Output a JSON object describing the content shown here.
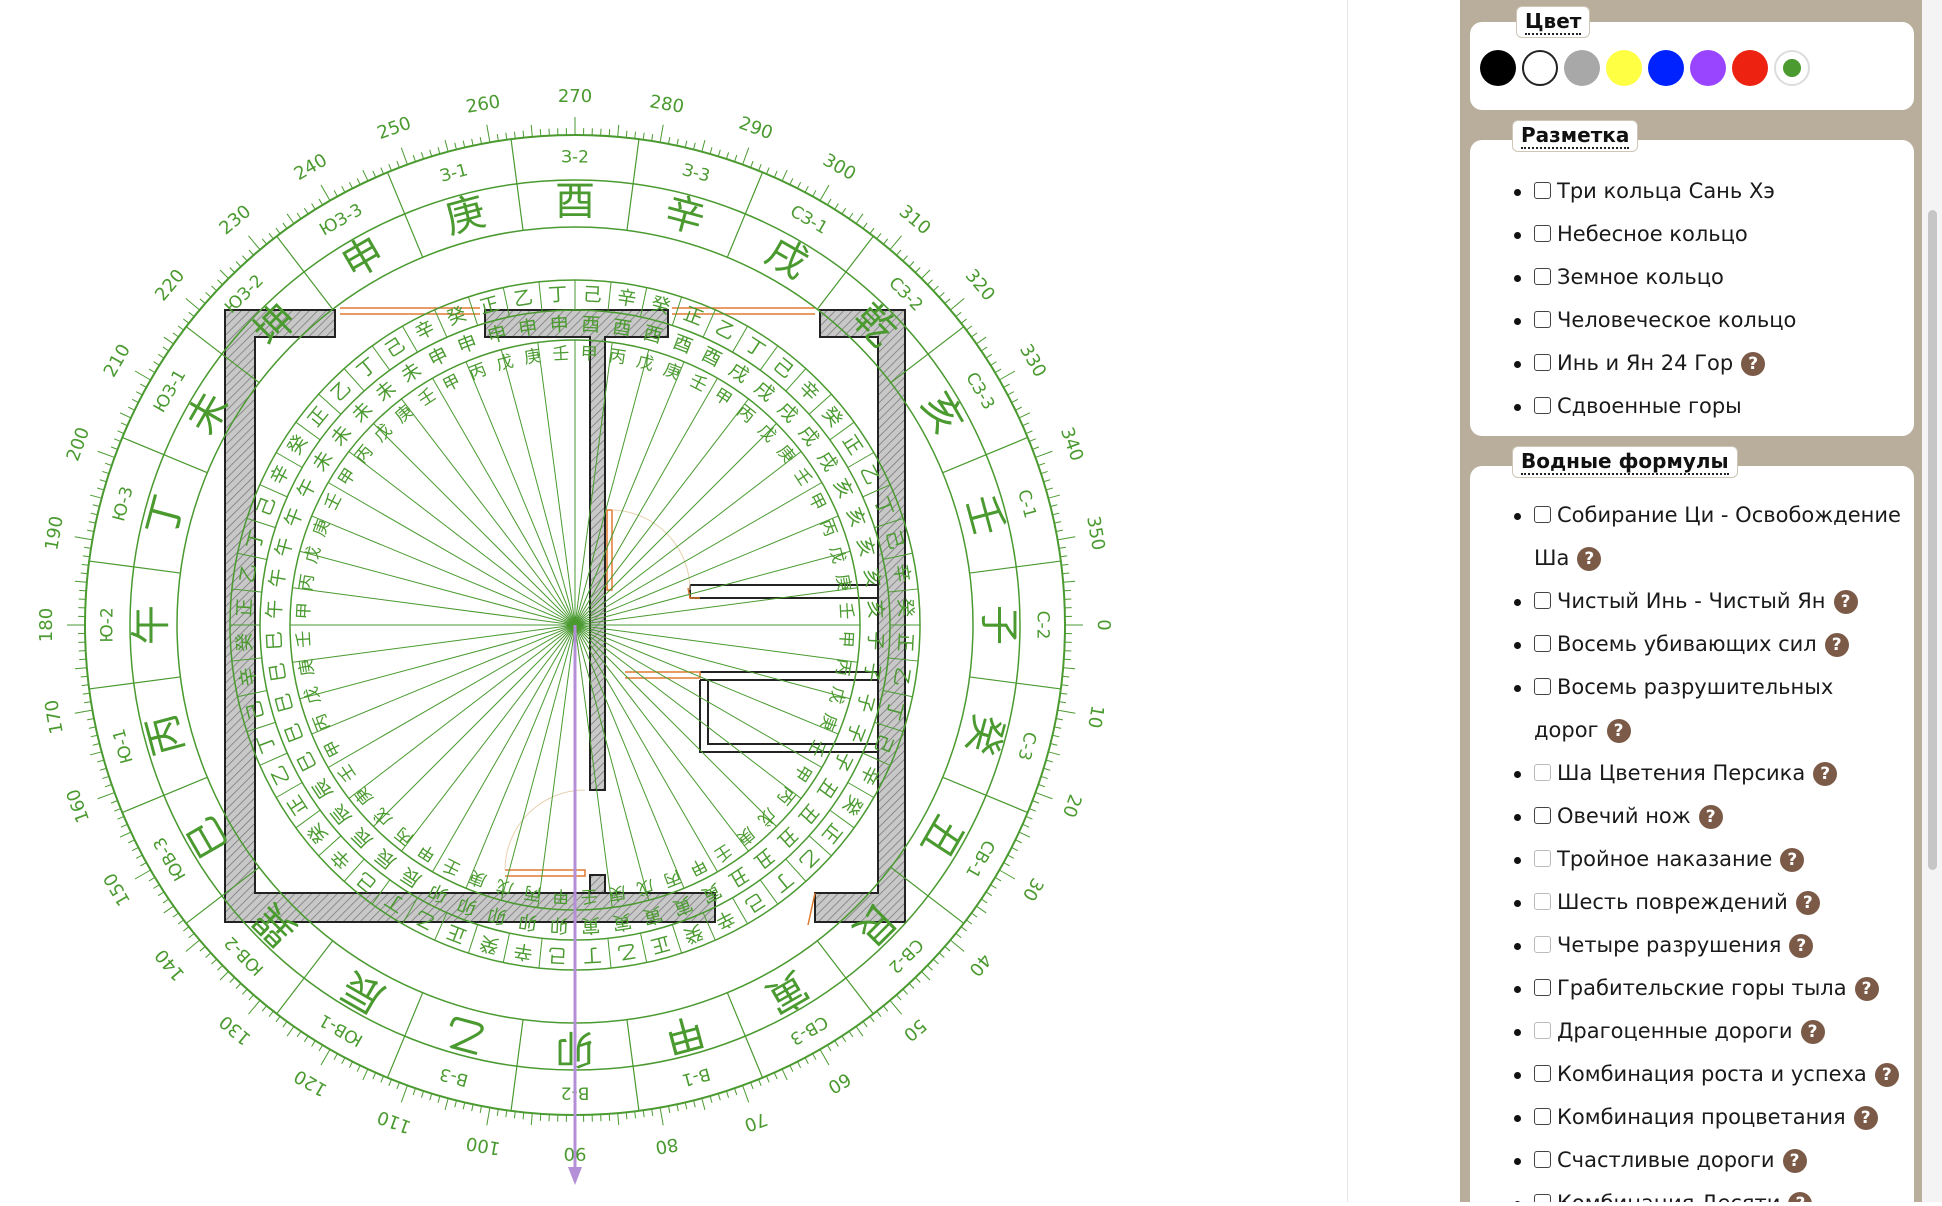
{
  "panel": {
    "color_group": {
      "title": "Цвет",
      "swatches": [
        "#000000",
        "#ffffff",
        "#a8a8a8",
        "#ffff44",
        "#0022ff",
        "#9944ff",
        "#ee2211",
        "#4a9a30"
      ],
      "selected": "#4a9a30"
    },
    "markup_group": {
      "title": "Разметка",
      "items": [
        {
          "label": "Три кольца Сань Хэ",
          "help": false
        },
        {
          "label": "Небесное кольцо",
          "help": false
        },
        {
          "label": "Земное кольцо",
          "help": false
        },
        {
          "label": "Человеческое кольцо",
          "help": false
        },
        {
          "label": "Инь и Ян 24 Гор",
          "help": true
        },
        {
          "label": "Сдвоенные горы",
          "help": false
        }
      ]
    },
    "water_group": {
      "title": "Водные формулы",
      "items": [
        {
          "label": "Собирание Ци - Освобождение",
          "label2": "Ша",
          "help": true,
          "disabled": false
        },
        {
          "label": "Чистый Инь - Чистый Ян",
          "help": true,
          "disabled": false
        },
        {
          "label": "Восемь убивающих сил",
          "help": true,
          "disabled": false
        },
        {
          "label": "Восемь разрушительных",
          "label2": "дорог",
          "help": true,
          "disabled": false
        },
        {
          "label": "Ша Цветения Персика",
          "help": true,
          "disabled": true
        },
        {
          "label": "Овечий нож",
          "help": true,
          "disabled": false
        },
        {
          "label": "Тройное наказание",
          "help": true,
          "disabled": true
        },
        {
          "label": "Шесть повреждений",
          "help": true,
          "disabled": true
        },
        {
          "label": "Четыре разрушения",
          "help": true,
          "disabled": true
        },
        {
          "label": "Грабительские горы тыла",
          "help": true,
          "disabled": false
        },
        {
          "label": "Драгоценные дороги",
          "help": true,
          "disabled": true
        },
        {
          "label": "Комбинация роста и успеха",
          "help": true,
          "disabled": false
        },
        {
          "label": "Комбинация процветания",
          "help": true,
          "disabled": false
        },
        {
          "label": "Счастливые дороги",
          "help": true,
          "disabled": false
        },
        {
          "label": "Комбинация Десяти",
          "help": true,
          "disabled": false
        }
      ]
    }
  },
  "compass": {
    "color": "#4a9a30",
    "arrow_color": "#b48fd8",
    "degree_labels": [
      "0",
      "10",
      "20",
      "30",
      "40",
      "50",
      "60",
      "70",
      "80",
      "90",
      "100",
      "110",
      "120",
      "130",
      "140",
      "150",
      "160",
      "170",
      "180",
      "190",
      "200",
      "210",
      "220",
      "230",
      "240",
      "250",
      "260",
      "270",
      "280",
      "290",
      "300",
      "310",
      "320",
      "330",
      "340",
      "350"
    ],
    "sector_labels": [
      "С-2",
      "С-3",
      "СВ-1",
      "СВ-2",
      "СВ-3",
      "В-1",
      "В-2",
      "В-3",
      "ЮВ-1",
      "ЮВ-2",
      "ЮВ-3",
      "Ю-1",
      "Ю-2",
      "Ю-3",
      "ЮЗ-1",
      "ЮЗ-2",
      "ЮЗ-3",
      "З-1",
      "З-2",
      "З-3",
      "СЗ-1",
      "СЗ-2",
      "СЗ-3",
      "С-1"
    ],
    "mountains": [
      "子",
      "癸",
      "丑",
      "艮",
      "寅",
      "甲",
      "卯",
      "乙",
      "辰",
      "巽",
      "巳",
      "丙",
      "午",
      "丁",
      "未",
      "坤",
      "申",
      "庚",
      "酉",
      "辛",
      "戌",
      "乾",
      "亥",
      "壬"
    ],
    "ring_chars_a": [
      "甲",
      "丙",
      "戊",
      "庚",
      "壬"
    ],
    "ring_chars_b": [
      "子",
      "丑",
      "寅",
      "卯",
      "辰",
      "巳",
      "午",
      "未",
      "申",
      "酉",
      "戌",
      "亥"
    ],
    "ring_chars_c": [
      "正",
      "乙",
      "丁",
      "己",
      "辛",
      "癸"
    ],
    "heading_deg": 90
  }
}
